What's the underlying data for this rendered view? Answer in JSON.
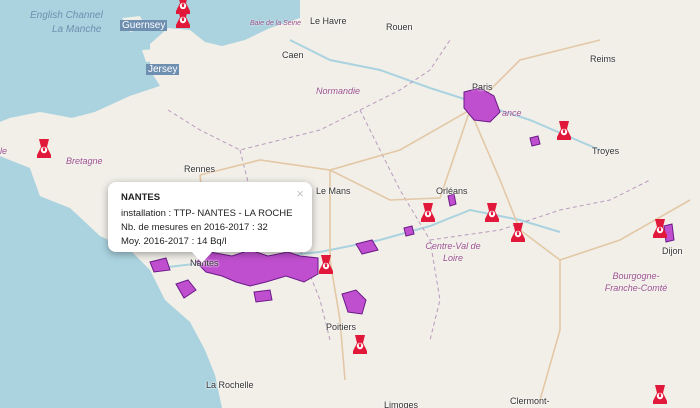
{
  "map": {
    "sea_labels": [
      "English Channel",
      "La Manche",
      "Baie de la Seine"
    ],
    "islands": [
      "Guernsey",
      "Jersey"
    ],
    "cities": [
      "Le Havre",
      "Rouen",
      "Caen",
      "Paris",
      "Reims",
      "Rennes",
      "Le Mans",
      "Orléans",
      "Troyes",
      "Nantes",
      "Poitiers",
      "La Rochelle",
      "Limoges",
      "Clermont-",
      "Dijon"
    ],
    "regions": [
      "Normandie",
      "Bretagne",
      "Centre-Val de Loire",
      "Bourgogne-Franche-Comté"
    ],
    "region_partial": [
      "le",
      "ance"
    ],
    "colors": {
      "water": "#aad3df",
      "land": "#f2efe9",
      "zone_fill": "#c04fd0",
      "zone_stroke": "#6a1a86",
      "plant": "#e2183a"
    },
    "markers": {
      "icon": "nuclear-plant-icon",
      "count": 11
    }
  },
  "popup": {
    "title": "NANTES",
    "installation": "installation : TTP- NANTES - LA ROCHE",
    "measures": "Nb. de mesures en 2016-2017 : 32",
    "average": "Moy. 2016-2017 : 14 Bq/l",
    "close": "×"
  }
}
